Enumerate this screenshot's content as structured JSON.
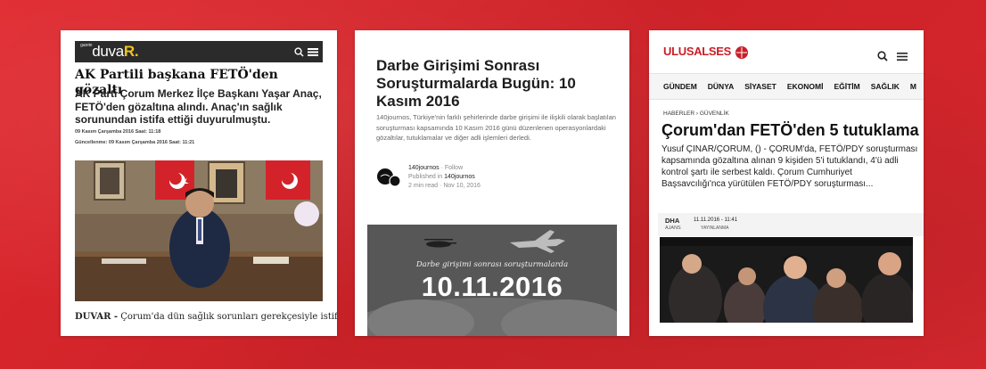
{
  "card1": {
    "logo_small": "gazete",
    "logo_main": "duva",
    "logo_accent": "R.",
    "headline": "AK Partili başkana FETÖ'den gözaltı",
    "lead": "AK Parti Çorum Merkez İlçe Başkanı Yaşar Anaç, FETÖ'den gözaltına alındı. Anaç'ın sağlık sorunundan istifa ettiği duyurulmuştu.",
    "published": "09 Kasım Çarşamba 2016   Saat: 11:18",
    "updated": "Güncellenme: 09 Kasım Çarşamba 2016   Saat: 11:21",
    "caption_source": "DUVAR -",
    "caption_text": " Çorum'da dün sağlık sorunları gerekçesiyle istifa"
  },
  "card2": {
    "headline": "Darbe Girişimi Sonrası Soruşturmalarda Bugün: 10 Kasım 2016",
    "description": "140journos, Türkiye'nin farklı şehirlerinde darbe girişimi ile ilişkili olarak başlatılan soruşturması kapsamında 10 Kasım 2016 günü düzenlenen operasyonlardaki gözaltılar, tutuklamalar ve diğer adli işlemleri derledi.",
    "author": "140journos",
    "follow": "Follow",
    "published_in_label": "Published in ",
    "published_in": "140journos",
    "read_time": "2 min read",
    "date": "Nov 10, 2016",
    "hero_subtitle": "Darbe girişimi sonrası soruşturmalarda",
    "hero_date": "10.11.2016"
  },
  "card3": {
    "logo": "ULUSALSES",
    "nav": [
      "GÜNDEM",
      "DÜNYA",
      "SİYASET",
      "EKONOMİ",
      "EĞİTİM",
      "SAĞLIK",
      "M"
    ],
    "breadcrumb": "HABERLER › GÜVENLİK",
    "headline": "Çorum'dan FETÖ'den 5 tutuklama",
    "lead": "Yusuf ÇINAR/ÇORUM, () - ÇORUM'da, FETÖ/PDY soruşturması kapsamında gözaltına alınan 9 kişiden 5'i tutuklandı, 4'ü adli kontrol şartı ile serbest kaldı. Çorum Cumhuriyet Başsavcılığı'nca yürütülen FETÖ/PDY soruşturması...",
    "source": "DHA",
    "source_label": "AJANS",
    "pub_date": "11.11.2016 - 11:41",
    "pub_label": "YAYINLANMA"
  },
  "colors": {
    "background": "#d8262c",
    "duvar_header": "#2b2b2b",
    "duvar_accent": "#f0c419",
    "ulusalses_red": "#c81f27"
  },
  "icons": [
    "search-icon",
    "menu-icon"
  ]
}
